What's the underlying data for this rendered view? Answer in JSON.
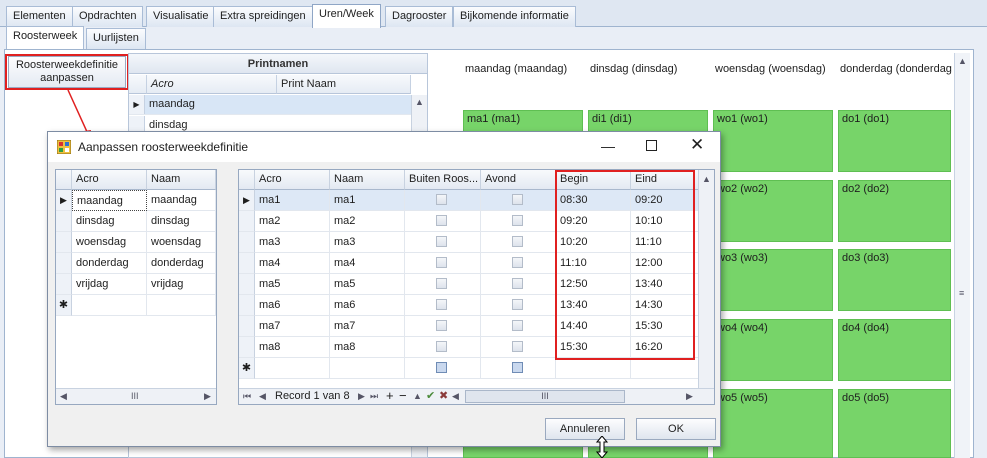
{
  "top_tabs": [
    "Elementen",
    "Opdrachten",
    "Visualisatie",
    "Extra spreidingen",
    "Uren/Week",
    "Dagrooster",
    "Bijkomende informatie"
  ],
  "sub_tabs": [
    "Roosterweek",
    "Uurlijsten"
  ],
  "callout_button": {
    "line1": "Roosterweekdefinitie",
    "line2": "aanpassen"
  },
  "printnamen": {
    "title": "Printnamen",
    "col_acro": "Acro",
    "col_print": "Print Naam",
    "rows": [
      "maandag",
      "dinsdag"
    ]
  },
  "schedule": {
    "days": [
      "maandag (maandag)",
      "dinsdag (dinsdag)",
      "woensdag (woensdag)",
      "donderdag (donderdag)"
    ],
    "cells": {
      "ma1": "ma1 (ma1)",
      "di1": "di1 (di1)",
      "wo1": "wo1 (wo1)",
      "do1": "do1 (do1)",
      "wo2": "wo2 (wo2)",
      "do2": "do2 (do2)",
      "wo3": "wo3 (wo3)",
      "do3": "do3 (do3)",
      "wo4": "wo4 (wo4)",
      "do4": "do4 (do4)",
      "wo5": "wo5 (wo5)",
      "do5": "do5 (do5)"
    }
  },
  "dialog": {
    "title": "Aanpassen roosterweekdefinitie",
    "left_grid": {
      "col_acro": "Acro",
      "col_naam": "Naam",
      "rows": [
        {
          "acro": "maandag",
          "naam": "maandag"
        },
        {
          "acro": "dinsdag",
          "naam": "dinsdag"
        },
        {
          "acro": "woensdag",
          "naam": "woensdag"
        },
        {
          "acro": "donderdag",
          "naam": "donderdag"
        },
        {
          "acro": "vrijdag",
          "naam": "vrijdag"
        }
      ]
    },
    "right_grid": {
      "columns": {
        "acro": "Acro",
        "naam": "Naam",
        "buiten": "Buiten Roos...",
        "avond": "Avond",
        "begin": "Begin",
        "eind": "Eind"
      },
      "rows": [
        {
          "acro": "ma1",
          "naam": "ma1",
          "begin": "08:30",
          "eind": "09:20"
        },
        {
          "acro": "ma2",
          "naam": "ma2",
          "begin": "09:20",
          "eind": "10:10"
        },
        {
          "acro": "ma3",
          "naam": "ma3",
          "begin": "10:20",
          "eind": "11:10"
        },
        {
          "acro": "ma4",
          "naam": "ma4",
          "begin": "11:10",
          "eind": "12:00"
        },
        {
          "acro": "ma5",
          "naam": "ma5",
          "begin": "12:50",
          "eind": "13:40"
        },
        {
          "acro": "ma6",
          "naam": "ma6",
          "begin": "13:40",
          "eind": "14:30"
        },
        {
          "acro": "ma7",
          "naam": "ma7",
          "begin": "14:40",
          "eind": "15:30"
        },
        {
          "acro": "ma8",
          "naam": "ma8",
          "begin": "15:30",
          "eind": "16:20"
        }
      ],
      "navigator": "Record 1 van 8"
    },
    "cancel_label": "Annuleren",
    "ok_label": "OK"
  },
  "colors": {
    "slot_green": "#77d469",
    "highlight_red": "#e02020"
  }
}
